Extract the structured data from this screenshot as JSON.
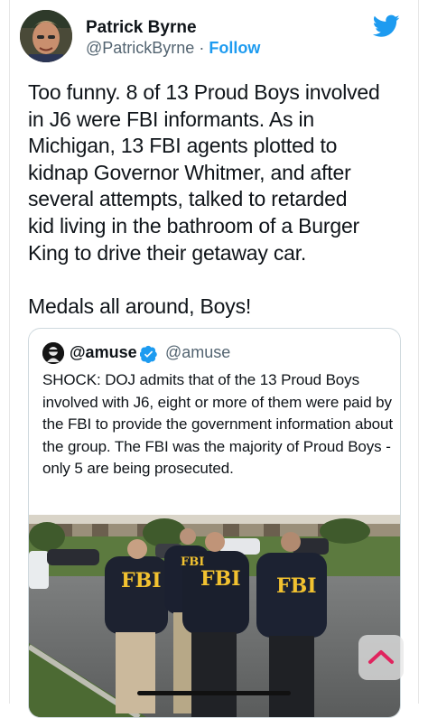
{
  "author": {
    "name": "Patrick Byrne",
    "handle": "@PatrickByrne",
    "separator": "·",
    "follow_label": "Follow"
  },
  "tweet": {
    "text": "Too funny. 8 of 13 Proud Boys involved\nin J6 were FBI informants. As in\nMichigan, 13 FBI agents plotted to\nkidnap Governor Whitmer, and after\nseveral attempts, talked to retarded\nkid living in the bathroom of a Burger\nKing to drive their getaway car.\n\nMedals all around, Boys!"
  },
  "quoted": {
    "name": "@amuse",
    "handle": "@amuse",
    "text": "SHOCK: DOJ admits that of the 13 Proud Boys involved with J6, eight or more of them were paid by the FBI to provide the government information about the group. The FBI was the majority of Proud Boys - only 5 are being prosecuted.",
    "photo_labels": [
      "FBI",
      "FBI",
      "FBI",
      "FBI"
    ]
  },
  "colors": {
    "accent": "#1d9bf0",
    "text": "#0f1419",
    "secondary": "#536471",
    "scroll_arrow": "#e0245e"
  },
  "icons": {
    "brand": "twitter-bird-icon",
    "verified": "verified-badge-icon",
    "scroll": "chevron-up-icon"
  }
}
